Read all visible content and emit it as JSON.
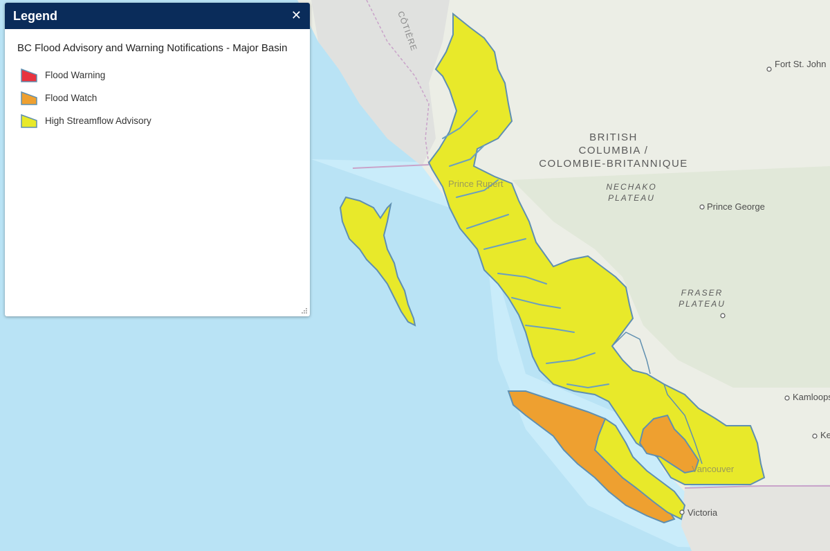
{
  "legend": {
    "title": "Legend",
    "close_glyph": "✕",
    "layer_title": "BC Flood Advisory and Warning Notifications - Major Basin",
    "items": [
      {
        "label": "Flood Warning",
        "fill": "#e8333f",
        "stroke": "#5f8fb0"
      },
      {
        "label": "Flood Watch",
        "fill": "#eea030",
        "stroke": "#5f8fb0"
      },
      {
        "label": "High Streamflow Advisory",
        "fill": "#e8e92a",
        "stroke": "#5f8fb0"
      }
    ]
  },
  "map": {
    "colors": {
      "ocean": "#b9e3f5",
      "land": "#eceee6",
      "advisory": "#e8e92a",
      "watch": "#eea030",
      "basin_outline": "#5f8fb0"
    },
    "places": {
      "fort_st_john": "Fort St. John",
      "prince_rupert": "Prince Rupert",
      "prince_george": "Prince George",
      "kamloops": "Kamloops",
      "ke": "Ke",
      "vancouver": "Vancouver",
      "victoria": "Victoria"
    },
    "regions": {
      "bc_line1": "BRITISH",
      "bc_line2": "COLUMBIA /",
      "bc_line3": "COLOMBIE-BRITANNIQUE",
      "nechako_1": "NECHAKO",
      "nechako_2": "PLATEAU",
      "fraser_1": "FRASER",
      "fraser_2": "PLATEAU",
      "cotiere": "CÔTIÈRE"
    }
  }
}
